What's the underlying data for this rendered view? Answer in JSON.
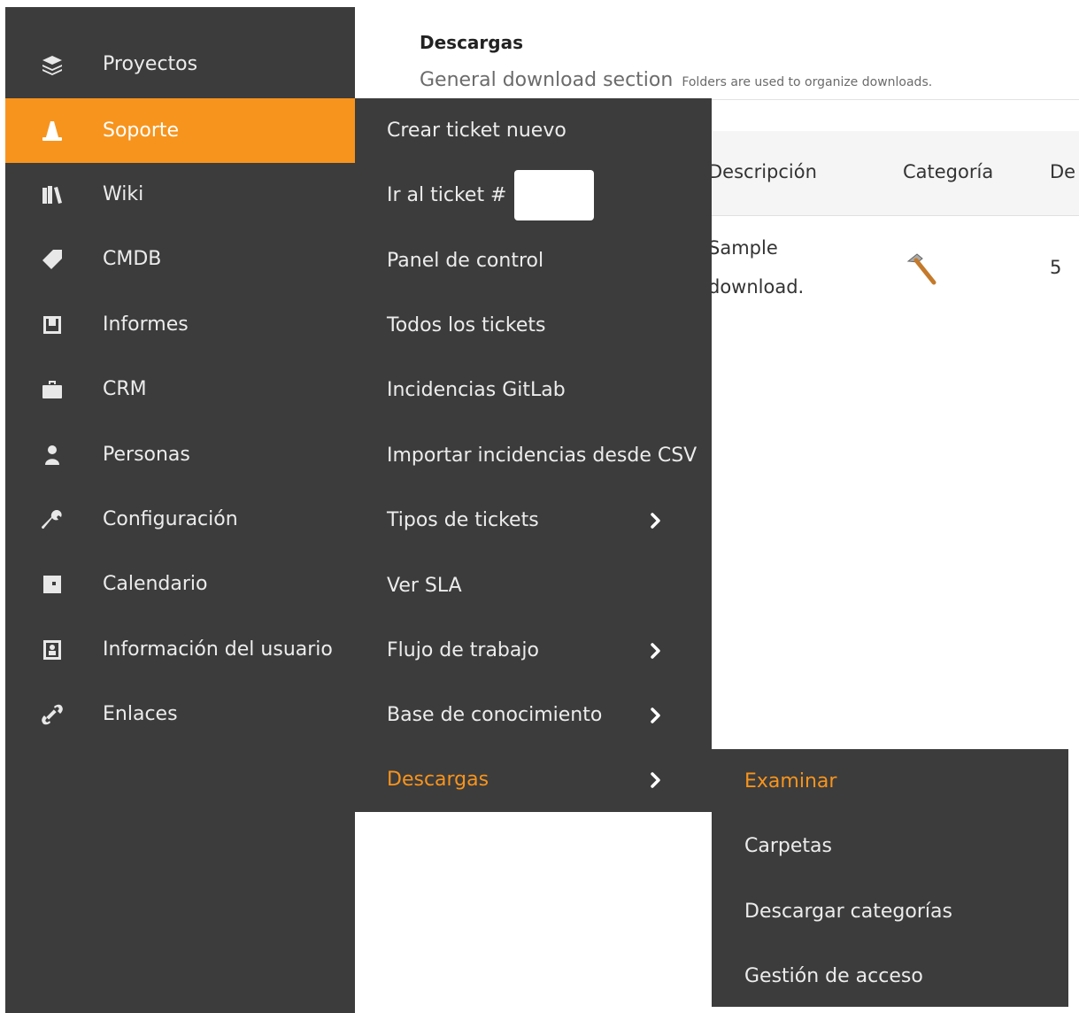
{
  "sidebar": {
    "items": [
      {
        "label": "Proyectos",
        "icon": "layers-icon"
      },
      {
        "label": "Soporte",
        "icon": "traffic-cone-icon",
        "active": true
      },
      {
        "label": "Wiki",
        "icon": "books-icon"
      },
      {
        "label": "CMDB",
        "icon": "tag-icon"
      },
      {
        "label": "Informes",
        "icon": "report-icon"
      },
      {
        "label": "CRM",
        "icon": "briefcase-icon"
      },
      {
        "label": "Personas",
        "icon": "person-icon"
      },
      {
        "label": "Configuración",
        "icon": "wrench-icon"
      },
      {
        "label": "Calendario",
        "icon": "calendar-icon"
      },
      {
        "label": "Información del usuario",
        "icon": "user-card-icon"
      },
      {
        "label": "Enlaces",
        "icon": "link-icon"
      }
    ]
  },
  "header": {
    "title": "Descargas",
    "subtitle": "General download section",
    "hint": "Folders are used to organize downloads."
  },
  "table": {
    "columns": [
      "Descripción",
      "Categoría",
      "De"
    ],
    "rows": [
      {
        "description_line1": "Sample",
        "description_line2": "download.",
        "category_icon": "hammer-icon",
        "value": "5"
      }
    ]
  },
  "submenu": {
    "items": [
      {
        "label": "Crear ticket nuevo"
      },
      {
        "label": "Ir al ticket #",
        "input_value": ""
      },
      {
        "label": "Panel de control"
      },
      {
        "label": "Todos los tickets"
      },
      {
        "label": "Incidencias GitLab"
      },
      {
        "label": "Importar incidencias desde CSV"
      },
      {
        "label": "Tipos de tickets",
        "has_submenu": true
      },
      {
        "label": "Ver SLA"
      },
      {
        "label": "Flujo de trabajo",
        "has_submenu": true
      },
      {
        "label": "Base de conocimiento",
        "has_submenu": true
      },
      {
        "label": "Descargas",
        "has_submenu": true,
        "highlight": true
      }
    ]
  },
  "downloads_submenu": {
    "items": [
      {
        "label": "Examinar",
        "highlight": true
      },
      {
        "label": "Carpetas"
      },
      {
        "label": "Descargar categorías"
      },
      {
        "label": "Gestión de acceso"
      }
    ]
  },
  "colors": {
    "sidebar_bg": "#3c3c3c",
    "accent": "#f7941d",
    "text_light": "#ececec"
  }
}
